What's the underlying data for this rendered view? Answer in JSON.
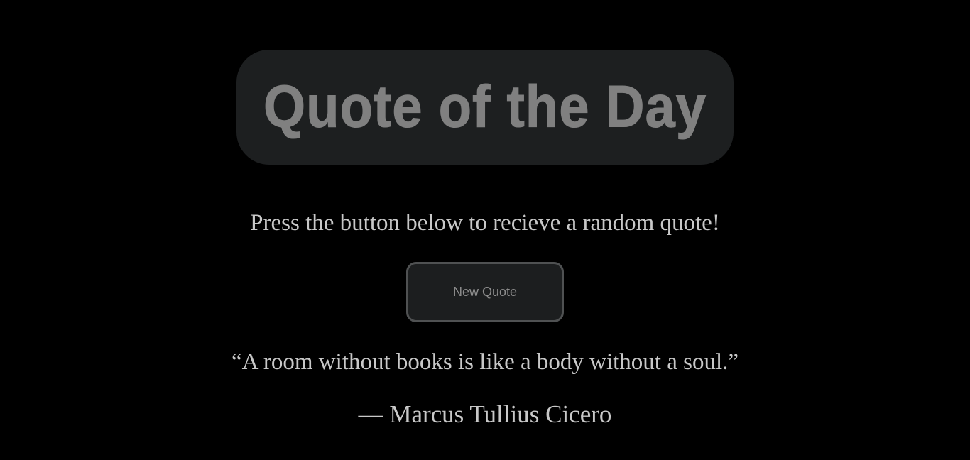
{
  "header": {
    "title": "Quote of the Day"
  },
  "instructions": "Press the button below to recieve a random quote!",
  "button": {
    "label": "New Quote"
  },
  "quote": {
    "text": "“A room without books is like a body without a soul.”",
    "author": "— Marcus Tullius Cicero"
  },
  "colors": {
    "background": "#000000",
    "header_box": "#1d1f20",
    "title_text": "#808080",
    "body_text": "#c8c8c8",
    "button_bg": "#1c1e1f",
    "button_border": "#4f5152",
    "button_text": "#8d8d8d"
  }
}
